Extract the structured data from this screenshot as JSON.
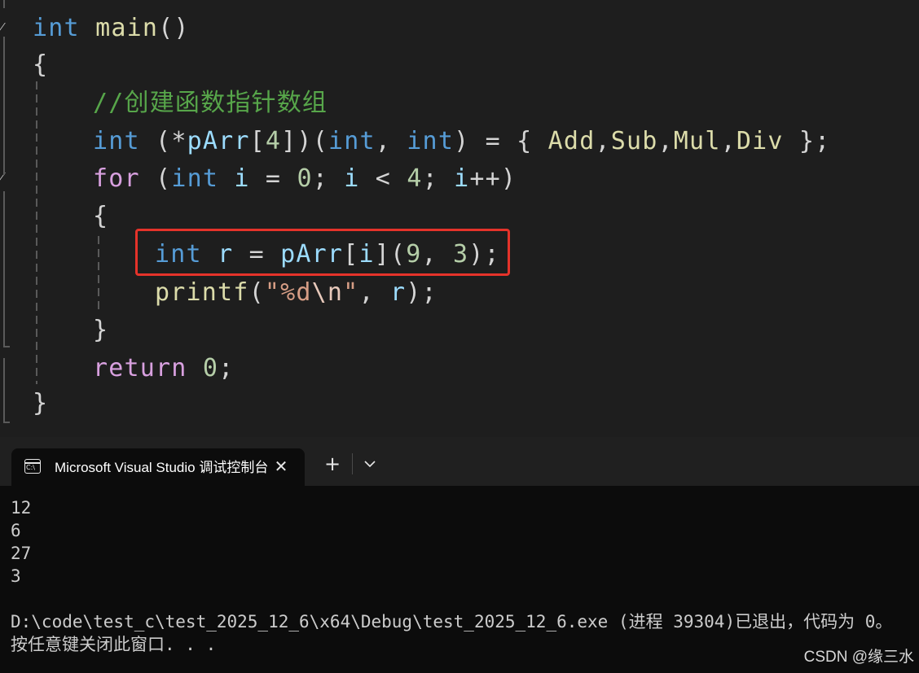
{
  "editor": {
    "lines": {
      "l1": [
        {
          "t": "int",
          "c": "k"
        },
        {
          "t": " ",
          "c": "p"
        },
        {
          "t": "main",
          "c": "fn"
        },
        {
          "t": "()",
          "c": "p"
        }
      ],
      "l2": [
        {
          "t": "{",
          "c": "p"
        }
      ],
      "l3": [
        {
          "t": "//创建函数指针数组",
          "c": "cm"
        }
      ],
      "l4": [
        {
          "t": "int",
          "c": "k"
        },
        {
          "t": " (*",
          "c": "p"
        },
        {
          "t": "pArr",
          "c": "v"
        },
        {
          "t": "[",
          "c": "p"
        },
        {
          "t": "4",
          "c": "n"
        },
        {
          "t": "])(",
          "c": "p"
        },
        {
          "t": "int",
          "c": "k"
        },
        {
          "t": ", ",
          "c": "p"
        },
        {
          "t": "int",
          "c": "k"
        },
        {
          "t": ") = { ",
          "c": "p"
        },
        {
          "t": "Add",
          "c": "fn"
        },
        {
          "t": ",",
          "c": "p"
        },
        {
          "t": "Sub",
          "c": "fn"
        },
        {
          "t": ",",
          "c": "p"
        },
        {
          "t": "Mul",
          "c": "fn"
        },
        {
          "t": ",",
          "c": "p"
        },
        {
          "t": "Div",
          "c": "fn"
        },
        {
          "t": " };",
          "c": "p"
        }
      ],
      "l5": [
        {
          "t": "for",
          "c": "c"
        },
        {
          "t": " (",
          "c": "p"
        },
        {
          "t": "int",
          "c": "k"
        },
        {
          "t": " ",
          "c": "p"
        },
        {
          "t": "i",
          "c": "v"
        },
        {
          "t": " = ",
          "c": "p"
        },
        {
          "t": "0",
          "c": "n"
        },
        {
          "t": "; ",
          "c": "p"
        },
        {
          "t": "i",
          "c": "v"
        },
        {
          "t": " < ",
          "c": "p"
        },
        {
          "t": "4",
          "c": "n"
        },
        {
          "t": "; ",
          "c": "p"
        },
        {
          "t": "i",
          "c": "v"
        },
        {
          "t": "++)",
          "c": "p"
        }
      ],
      "l6": [
        {
          "t": "{",
          "c": "p"
        }
      ],
      "l7": [
        {
          "t": "int",
          "c": "k"
        },
        {
          "t": " ",
          "c": "p"
        },
        {
          "t": "r",
          "c": "v"
        },
        {
          "t": " = ",
          "c": "p"
        },
        {
          "t": "pArr",
          "c": "v"
        },
        {
          "t": "[",
          "c": "p"
        },
        {
          "t": "i",
          "c": "v"
        },
        {
          "t": "](",
          "c": "p"
        },
        {
          "t": "9",
          "c": "n"
        },
        {
          "t": ", ",
          "c": "p"
        },
        {
          "t": "3",
          "c": "n"
        },
        {
          "t": ");",
          "c": "p"
        }
      ],
      "l8": [
        {
          "t": "printf",
          "c": "fn"
        },
        {
          "t": "(",
          "c": "p"
        },
        {
          "t": "\"%d",
          "c": "s"
        },
        {
          "t": "\\n",
          "c": "esc"
        },
        {
          "t": "\"",
          "c": "s"
        },
        {
          "t": ", ",
          "c": "p"
        },
        {
          "t": "r",
          "c": "v"
        },
        {
          "t": ");",
          "c": "p"
        }
      ],
      "l9": [
        {
          "t": "}",
          "c": "p"
        }
      ],
      "l10": [
        {
          "t": "return",
          "c": "c"
        },
        {
          "t": " ",
          "c": "p"
        },
        {
          "t": "0",
          "c": "n"
        },
        {
          "t": ";",
          "c": "p"
        }
      ],
      "l11": [
        {
          "t": "}",
          "c": "p"
        }
      ]
    }
  },
  "colors": {
    "editor_bg": "#1e1e1e",
    "keyword": "#569cd6",
    "control_keyword": "#d8a0df",
    "comment": "#57a64a",
    "function": "#dcdcaa",
    "variable": "#9cdcfe",
    "number": "#b5cea8",
    "string": "#d69d85",
    "highlight_box": "#e5332a",
    "terminal_bg": "#0c0c0c"
  },
  "terminal": {
    "tab": {
      "icon": "console-icon",
      "icon_text": "C:\\",
      "title": "Microsoft Visual Studio 调试控制台",
      "close_glyph": "✕"
    },
    "new_tab_glyph": "+",
    "dropdown_icon": "chevron-down-icon",
    "output": {
      "l1": "12",
      "l2": "6",
      "l3": "27",
      "l4": "3",
      "l5": "",
      "l6": "D:\\code\\test_c\\test_2025_12_6\\x64\\Debug\\test_2025_12_6.exe (进程 39304)已退出，代码为 0。",
      "l7": "按任意键关闭此窗口. . ."
    }
  },
  "watermark": "CSDN @缘三水"
}
